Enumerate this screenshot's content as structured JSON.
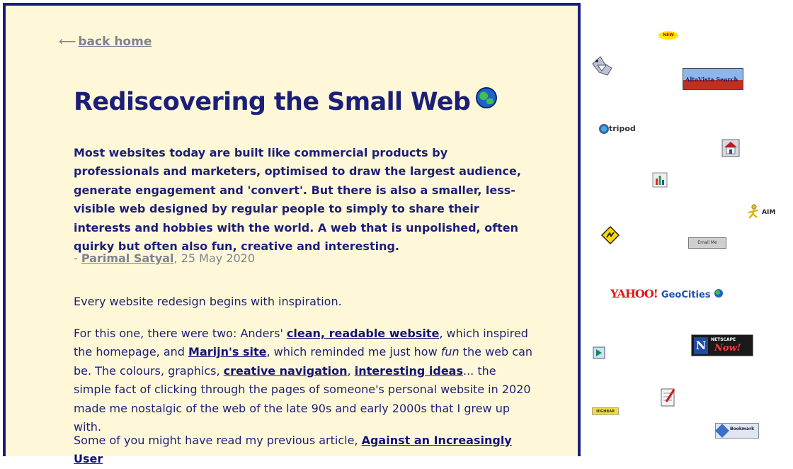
{
  "nav": {
    "back_arrow": "⟵",
    "back_label": "back home"
  },
  "article": {
    "title": "Rediscovering the Small Web",
    "title_emoji": "earth-globe-icon",
    "lead": "Most websites today are built like commercial products by professionals and marketers, optimised to draw the largest audience, generate engagement and 'convert'. But there is also a smaller, less-visible web designed by regular people to simply to share their interests and hobbies with the world. A web that is unpolished, often quirky but often also fun, creative and interesting.",
    "byline": {
      "prefix": "- ",
      "author": "Parimal Satyal",
      "date": ", 25 May 2020"
    },
    "p1": "Every website redesign begins with inspiration.",
    "p2": {
      "t1": "For this one, there were two: Anders' ",
      "link1": "clean, readable website",
      "t2": ", which inspired the homepage, and ",
      "link2": "Marijn's site",
      "t3": ", which reminded me just how ",
      "em": "fun",
      "t4": " the web can be. The colours, graphics, ",
      "link3": "creative navigation",
      "t5": ", ",
      "link4": "interesting ideas",
      "t6": "... the simple fact of clicking through the pages of someone's personal website in 2020 made me nostalgic of the web of the late 90s and early 2000s that I grew up with."
    },
    "p3": {
      "t1": "Some of you might have read my previous article, ",
      "link1": "Against an Increasingly User"
    }
  },
  "sidebar_gifs": {
    "new_badge": "NEW",
    "altavista_text": "AltaVista Search",
    "tripod_text": "tripod",
    "aim_text": "AIM",
    "email_text": "Email Me",
    "yahoo_text": "YAHOO!",
    "geocities_text": "GeoCities",
    "netscape_text": "NETSCAPE",
    "netscape_now": "Now!",
    "mini_badge": "HIGHBAR",
    "bookmark_text": "Bookmark"
  },
  "colors": {
    "panel_background": "#fff8d8",
    "panel_border": "#1c1f78",
    "text_primary": "#1c1f78",
    "text_muted": "#7d8390"
  }
}
